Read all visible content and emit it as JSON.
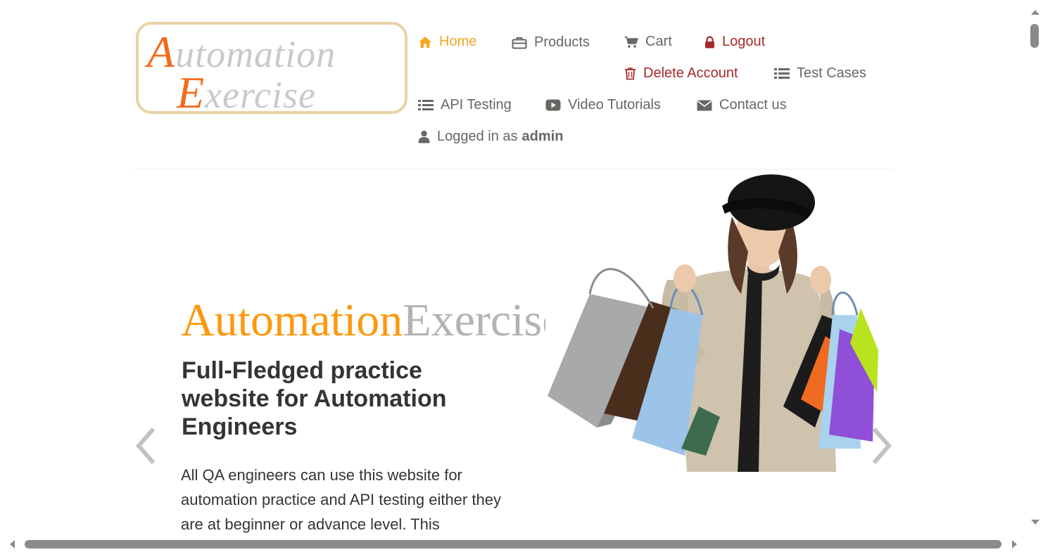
{
  "logo": {
    "line1_cap": "A",
    "line1_rest": "utomation",
    "line2_cap": "E",
    "line2_rest": "xercise"
  },
  "nav": {
    "home": "Home",
    "products": "Products",
    "cart": "Cart",
    "logout": "Logout",
    "delete_account": "Delete Account",
    "test_cases": "Test Cases",
    "api_testing": "API Testing",
    "video_tutorials": "Video Tutorials",
    "contact_us": "Contact us",
    "logged_in_prefix": "Logged in as",
    "logged_in_user": "admin"
  },
  "hero": {
    "title_orange": "Automation",
    "title_grey": "Exercise",
    "subtitle": "Full-Fledged practice website for Automation Engineers",
    "description": "All QA engineers can use this website for automation practice and API testing either they are at beginner or advance level. This"
  },
  "colors": {
    "accent": "#fe980f",
    "danger": "#a52a2a",
    "text": "#696763",
    "heading": "#363432"
  },
  "icons": {
    "home": "home-icon",
    "products": "briefcase-icon",
    "cart": "cart-icon",
    "logout": "lock-icon",
    "delete": "trash-icon",
    "test_cases": "list-icon",
    "api": "list-icon",
    "video": "youtube-play-icon",
    "contact": "envelope-icon",
    "user": "user-icon"
  }
}
